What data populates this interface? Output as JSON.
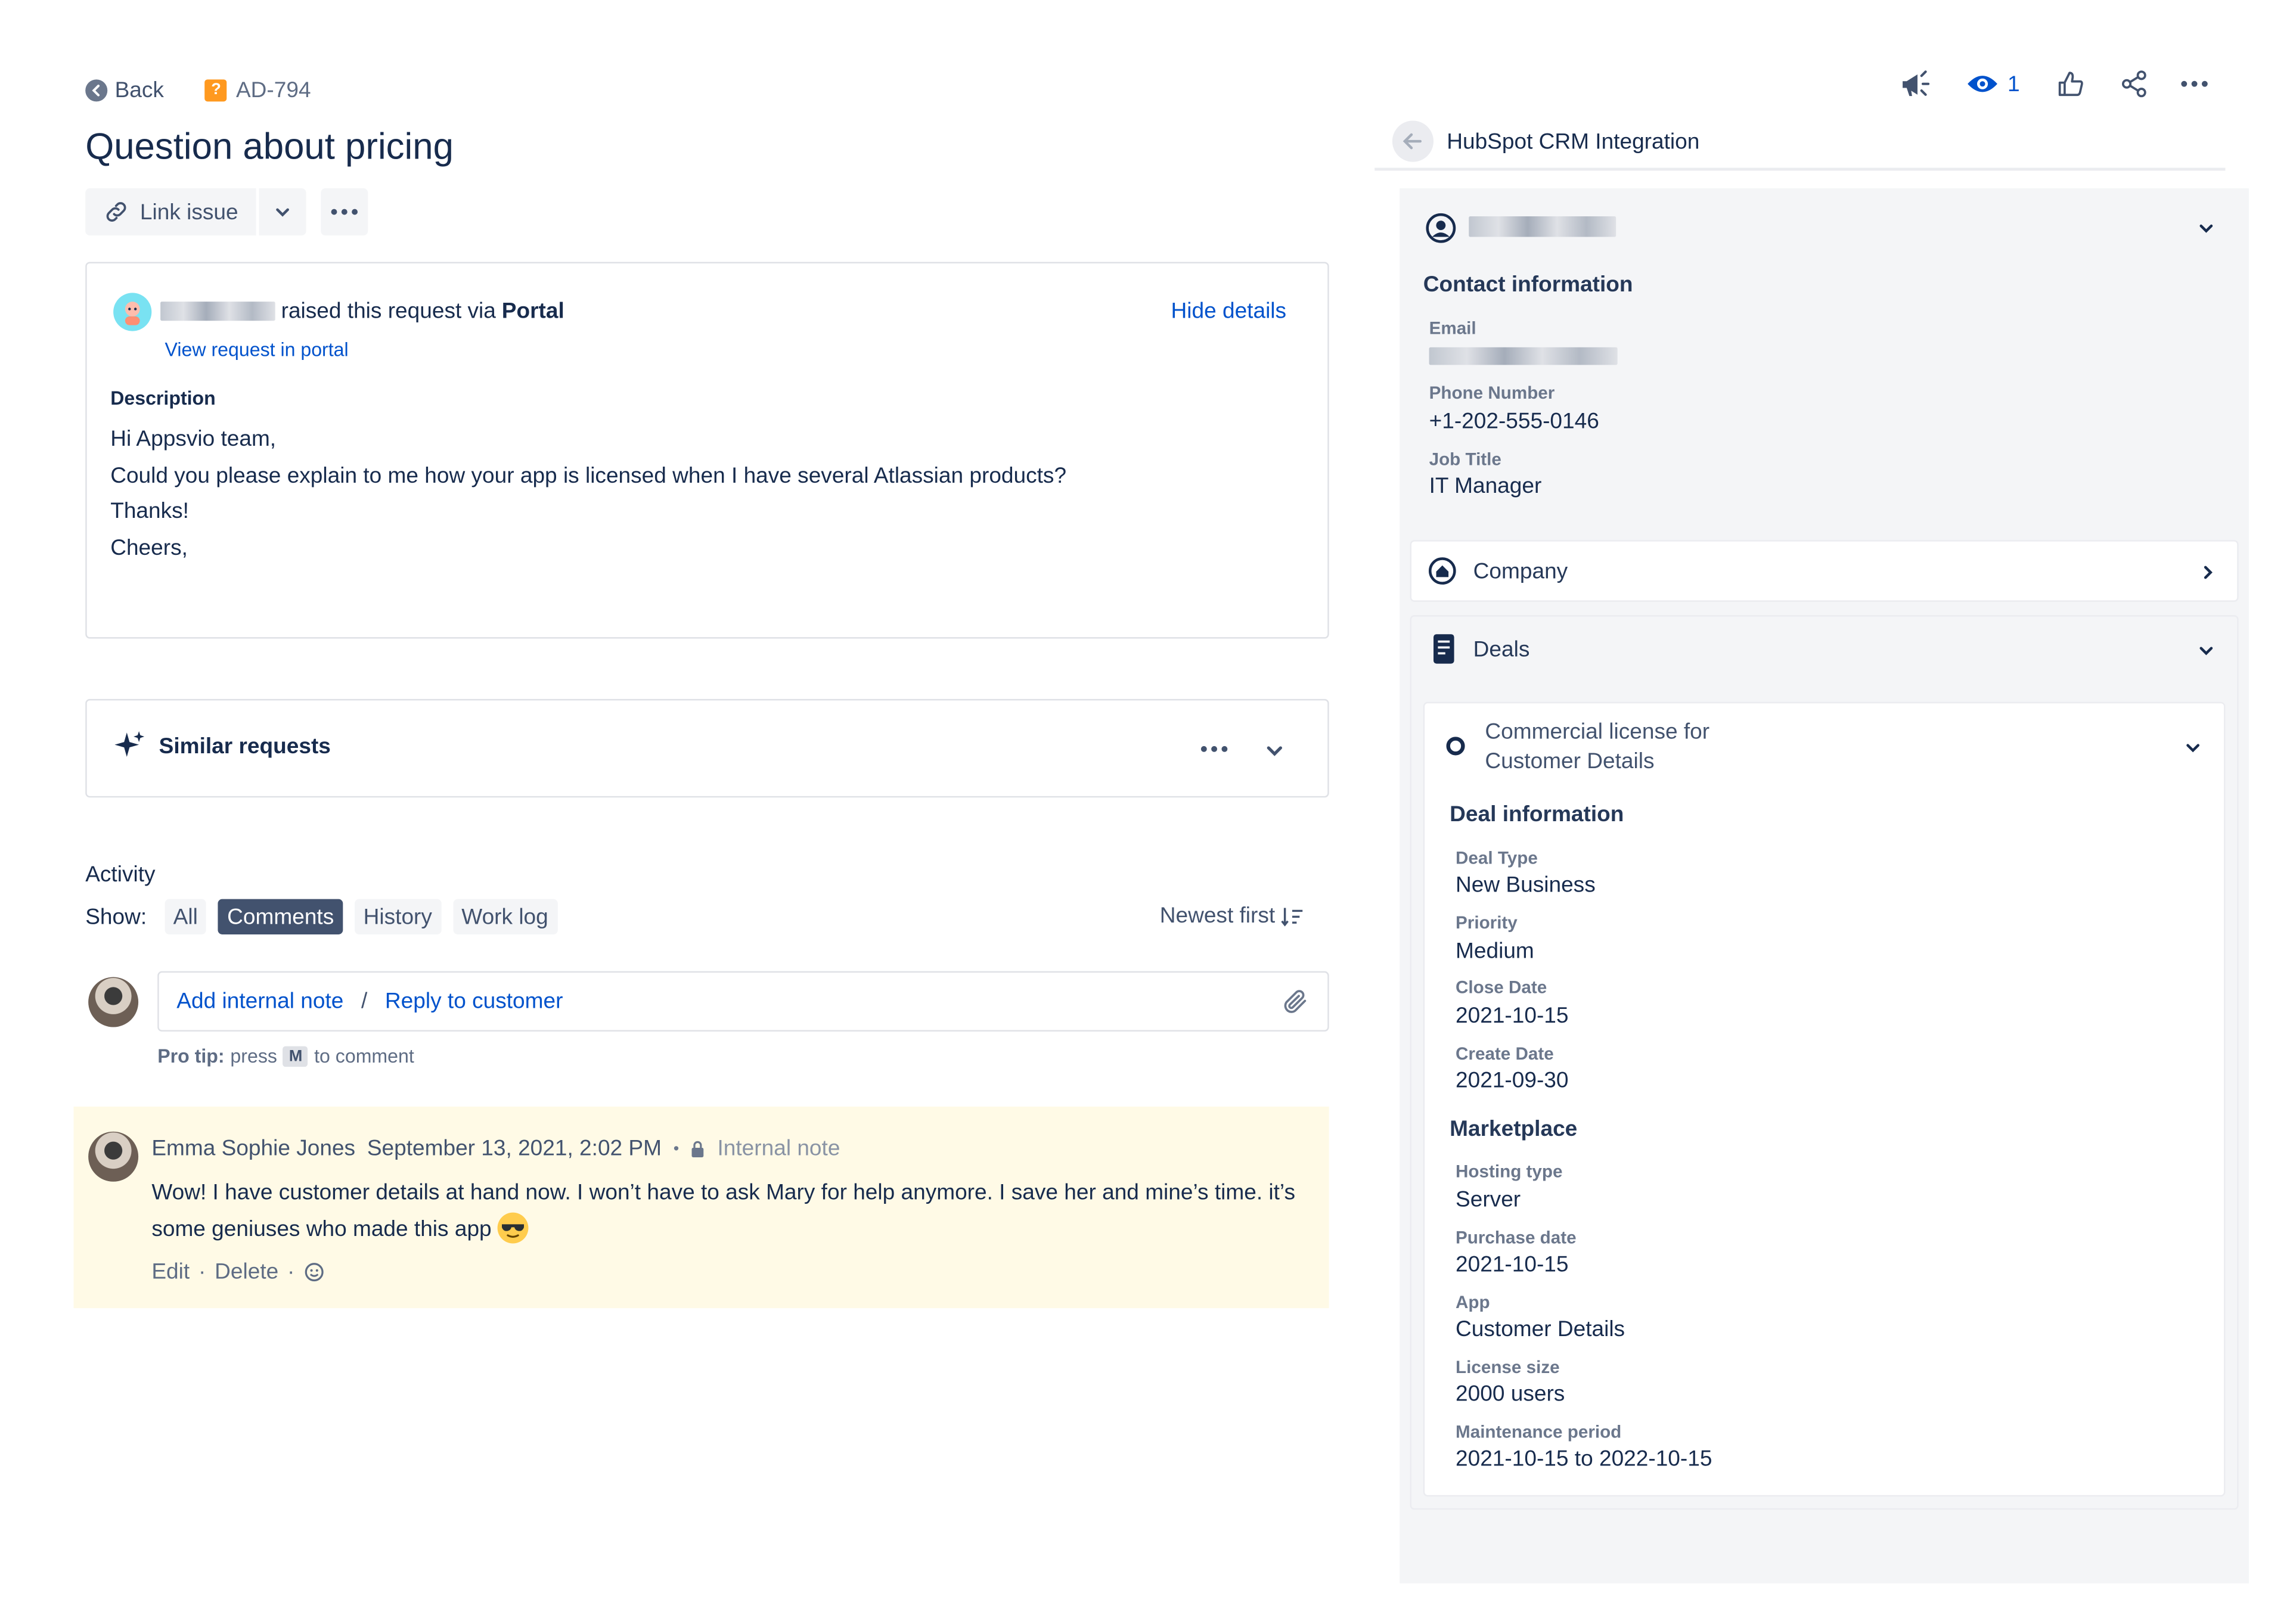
{
  "header": {
    "back_label": "Back",
    "issue_key": "AD-794",
    "issue_type_glyph": "?",
    "title": "Question about pricing"
  },
  "toolbar": {
    "link_issue_label": "Link issue"
  },
  "request": {
    "raised_text": "raised this request via",
    "channel": "Portal",
    "view_portal_label": "View request in portal",
    "hide_details_label": "Hide details",
    "description_label": "Description",
    "description_lines": [
      "Hi Appsvio team,",
      "Could you please explain to me how your app is licensed when I have several Atlassian products?",
      "Thanks!",
      "Cheers,"
    ]
  },
  "similar": {
    "label": "Similar requests"
  },
  "activity": {
    "label": "Activity",
    "show_label": "Show:",
    "filters": [
      "All",
      "Comments",
      "History",
      "Work log"
    ],
    "active_filter": "Comments",
    "sort_label": "Newest first",
    "add_note_label": "Add internal note",
    "separator": "/",
    "reply_label": "Reply to customer",
    "pro_tip_prefix": "Pro tip:",
    "pro_tip_press": "press",
    "pro_tip_key": "M",
    "pro_tip_suffix": "to comment"
  },
  "comment": {
    "author": "Emma Sophie Jones",
    "timestamp": "September 13, 2021, 2:02 PM",
    "bullet": "•",
    "visibility": "Internal note",
    "body": "Wow! I have customer details at hand now. I won’t have to ask Mary for help anymore. I save her and mine’s time. it’s some geniuses who made this app",
    "edit_label": "Edit",
    "delete_label": "Delete",
    "dot": "·"
  },
  "top_actions": {
    "watch_count": "1"
  },
  "panel": {
    "title": "HubSpot CRM Integration",
    "contact": {
      "section_title": "Contact information",
      "email_label": "Email",
      "phone_label": "Phone Number",
      "phone_value": "+1-202-555-0146",
      "job_label": "Job Title",
      "job_value": "IT Manager"
    },
    "company_label": "Company",
    "deals_label": "Deals",
    "deal": {
      "name_line1": "Commercial license for",
      "name_line2": "Customer Details",
      "info_title": "Deal information",
      "deal_type_label": "Deal Type",
      "deal_type_value": "New Business",
      "priority_label": "Priority",
      "priority_value": "Medium",
      "close_label": "Close Date",
      "close_value": "2021-10-15",
      "create_label": "Create Date",
      "create_value": "2021-09-30",
      "marketplace_title": "Marketplace",
      "hosting_label": "Hosting type",
      "hosting_value": "Server",
      "purchase_label": "Purchase date",
      "purchase_value": "2021-10-15",
      "app_label": "App",
      "app_value": "Customer Details",
      "license_label": "License size",
      "license_value": "2000 users",
      "maintenance_label": "Maintenance period",
      "maintenance_value": "2021-10-15 to 2022-10-15"
    }
  }
}
